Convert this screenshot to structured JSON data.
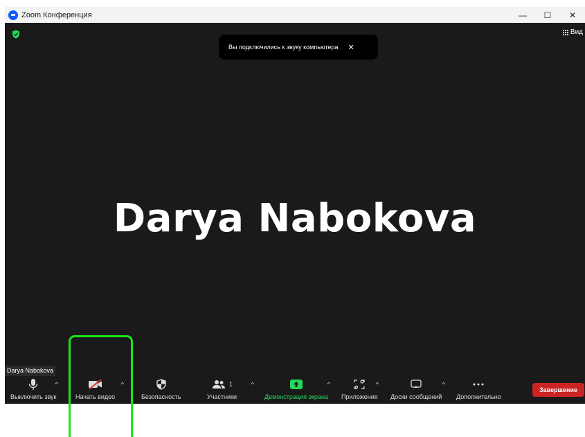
{
  "window": {
    "title": "Zoom Конференция",
    "controls": {
      "minimize": "—",
      "maximize": "☐",
      "close": "✕"
    }
  },
  "meeting": {
    "view_label": "Вид",
    "toast": {
      "text": "Вы подключились к звуку компьютера",
      "close": "✕"
    },
    "participant_name": "Darya Nabokova",
    "name_tag": "Darya Nabokova",
    "participant_count": "1"
  },
  "toolbar": {
    "mute_label": "Выключить звук",
    "video_label": "Начать видео",
    "security_label": "Безопасность",
    "participants_label": "Участники",
    "share_label": "Демонстрация экрана",
    "apps_label": "Приложения",
    "whiteboards_label": "Доски сообщений",
    "more_label": "Дополнительно",
    "end_label": "Завершение",
    "caret": "^"
  },
  "colors": {
    "meeting_bg": "#1a1a1a",
    "share_green": "#23d959",
    "end_red": "#cc2424",
    "highlight_green": "#19e619",
    "brand_blue": "#0b5cff"
  }
}
